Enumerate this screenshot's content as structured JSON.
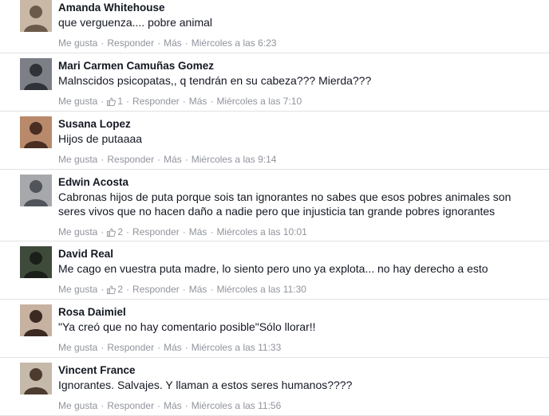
{
  "labels": {
    "like": "Me gusta",
    "reply": "Responder",
    "more": "Más",
    "dot": "·"
  },
  "colors": {
    "text": "#141823",
    "meta": "#90949c",
    "divider": "#e1e2e3",
    "link": "#3b5998"
  },
  "comments": [
    {
      "name": "Amanda Whitehouse",
      "text": "que verguenza.... pobre animal",
      "likes": null,
      "time": "Miércoles a las 6:23",
      "avatar_icon": "profile-photo"
    },
    {
      "name": "Mari Carmen Camuñas Gomez",
      "text": "Malnscidos psicopatas,, q tendrán en su cabeza??? Mierda???",
      "likes": "1",
      "time": "Miércoles a las 7:10",
      "avatar_icon": "profile-photo"
    },
    {
      "name": "Susana Lopez",
      "text": "Hijos de putaaaa",
      "likes": null,
      "time": "Miércoles a las 9:14",
      "avatar_icon": "profile-photo"
    },
    {
      "name": "Edwin Acosta",
      "text": "Cabronas hijos de puta porque sois tan ignorantes no sabes que esos pobres animales son seres vivos que no hacen daño a nadie pero que injusticia tan grande pobres ignorantes",
      "likes": "2",
      "time": "Miércoles a las 10:01",
      "avatar_icon": "profile-photo"
    },
    {
      "name": "David Real",
      "text": "Me cago en vuestra puta madre, lo siento pero uno ya explota... no hay derecho a esto",
      "likes": "2",
      "time": "Miércoles a las 11:30",
      "avatar_icon": "profile-photo"
    },
    {
      "name": "Rosa Daimiel",
      "text": "\"Ya creó que no hay comentario posible\"Sólo llorar!!",
      "likes": null,
      "time": "Miércoles a las 11:33",
      "avatar_icon": "profile-photo"
    },
    {
      "name": "Vincent France",
      "text": "Ignorantes. Salvajes. Y llaman a estos seres humanos????",
      "likes": null,
      "time": "Miércoles a las 11:56",
      "avatar_icon": "profile-photo"
    }
  ]
}
